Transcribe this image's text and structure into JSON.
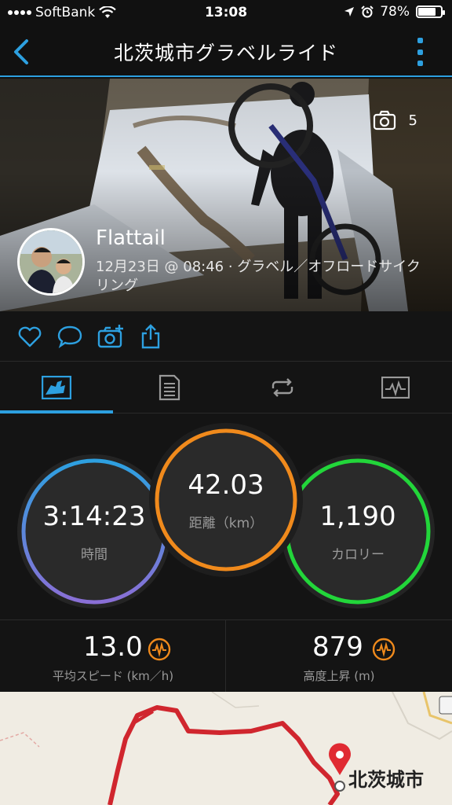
{
  "status_bar": {
    "carrier": "SoftBank",
    "time": "13:08",
    "battery": "78%",
    "battery_level": 0.78
  },
  "nav": {
    "title": "北茨城市グラベルライド"
  },
  "hero": {
    "photo_count": "5",
    "user_name": "Flattail",
    "meta": "12月23日 @ 08:46 · グラベル／オフロードサイクリング"
  },
  "summary": {
    "time_value": "3:14:23",
    "time_label": "時間",
    "distance_value": "42.03",
    "distance_label": "距離（km）",
    "calories_value": "1,190",
    "calories_label": "カロリー"
  },
  "stats": {
    "avg_speed_value": "13.0",
    "avg_speed_label": "平均スピード (km／h)",
    "elevation_value": "879",
    "elevation_label": "高度上昇 (m)"
  },
  "map": {
    "place_label": "北茨城市"
  },
  "colors": {
    "accent": "#2da0e0",
    "time_ring": "#7b73d6",
    "distance_ring": "#f08a1c",
    "calories_ring": "#22d63a",
    "route": "#d0262e",
    "pulse_icon": "#f08a1c"
  }
}
